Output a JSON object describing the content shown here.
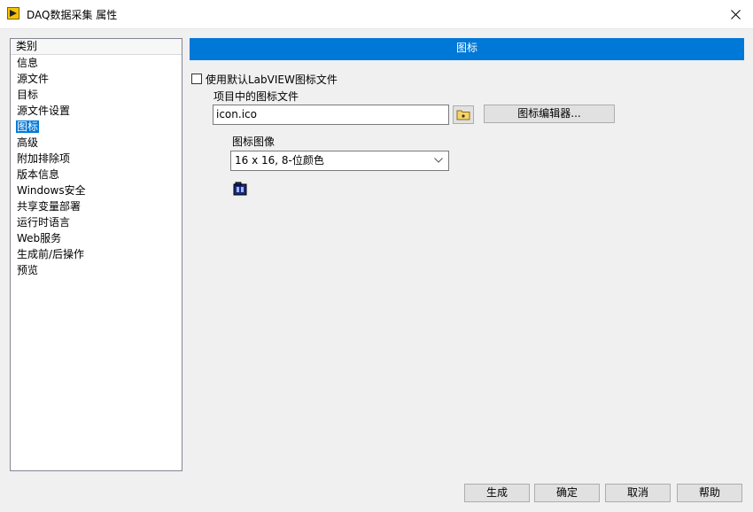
{
  "window": {
    "title": "DAQ数据采集 属性"
  },
  "categories": {
    "header": "类别",
    "items": [
      {
        "label": "信息"
      },
      {
        "label": "源文件"
      },
      {
        "label": "目标"
      },
      {
        "label": "源文件设置"
      },
      {
        "label": "图标",
        "selected": true
      },
      {
        "label": "高级"
      },
      {
        "label": "附加排除项"
      },
      {
        "label": "版本信息"
      },
      {
        "label": "Windows安全"
      },
      {
        "label": "共享变量部署"
      },
      {
        "label": "运行时语言"
      },
      {
        "label": "Web服务"
      },
      {
        "label": "生成前/后操作"
      },
      {
        "label": "预览"
      }
    ]
  },
  "panel": {
    "header": "图标",
    "use_default_checkbox": {
      "label": "使用默认LabVIEW图标文件",
      "checked": false
    },
    "icon_file_label": "项目中的图标文件",
    "icon_file_value": "icon.ico",
    "icon_editor_button": "图标编辑器...",
    "icon_image_label": "图标图像",
    "icon_image_selected": "16 x 16, 8-位颜色"
  },
  "buttons": {
    "build": "生成",
    "ok": "确定",
    "cancel": "取消",
    "help": "帮助"
  },
  "colors": {
    "accent": "#0078d7",
    "window_bg": "#f0f0f0"
  }
}
